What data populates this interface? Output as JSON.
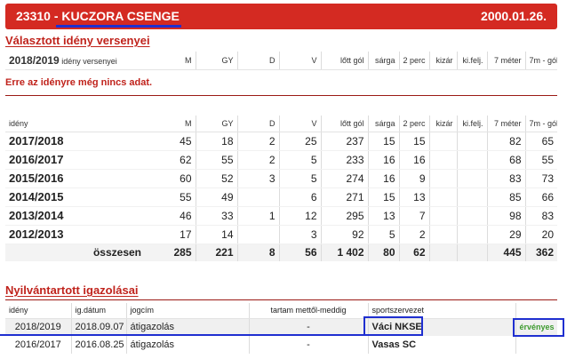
{
  "header": {
    "player_id": "23310",
    "separator": "-",
    "player_name": "KUCZORA CSENGE",
    "birth_date": "2000.01.26."
  },
  "selected_season": {
    "title": "Választott idény versenyei",
    "season": "2018/2019",
    "sub_label": "idény versenyei",
    "columns": [
      "M",
      "GY",
      "D",
      "V",
      "lőtt gól",
      "sárga",
      "2 perc",
      "kizár",
      "ki.felj.",
      "7 méter",
      "7m - gól"
    ],
    "no_data": "Erre az idényre még nincs adat."
  },
  "season_stats": {
    "header_label": "idény",
    "columns": [
      "M",
      "GY",
      "D",
      "V",
      "lőtt gól",
      "sárga",
      "2 perc",
      "kizár",
      "ki.felj.",
      "7 méter",
      "7m - gól"
    ],
    "rows": [
      {
        "season": "2017/2018",
        "values": [
          "45",
          "18",
          "2",
          "25",
          "237",
          "15",
          "15",
          "",
          "",
          "82",
          "65"
        ]
      },
      {
        "season": "2016/2017",
        "values": [
          "62",
          "55",
          "2",
          "5",
          "233",
          "16",
          "16",
          "",
          "",
          "68",
          "55"
        ]
      },
      {
        "season": "2015/2016",
        "values": [
          "60",
          "52",
          "3",
          "5",
          "274",
          "16",
          "9",
          "",
          "",
          "83",
          "73"
        ]
      },
      {
        "season": "2014/2015",
        "values": [
          "55",
          "49",
          "",
          "6",
          "271",
          "15",
          "13",
          "",
          "",
          "85",
          "66"
        ]
      },
      {
        "season": "2013/2014",
        "values": [
          "46",
          "33",
          "1",
          "12",
          "295",
          "13",
          "7",
          "",
          "",
          "98",
          "83"
        ]
      },
      {
        "season": "2012/2013",
        "values": [
          "17",
          "14",
          "",
          "3",
          "92",
          "5",
          "2",
          "",
          "",
          "29",
          "20"
        ]
      }
    ],
    "total": {
      "label": "összesen",
      "values": [
        "285",
        "221",
        "8",
        "56",
        "1 402",
        "80",
        "62",
        "",
        "",
        "445",
        "362"
      ]
    }
  },
  "registrations": {
    "title": "Nyilvántartott igazolásai",
    "columns": [
      "idény",
      "ig.dátum",
      "jogcím",
      "tartam mettől-meddig",
      "sportszervezet",
      ""
    ],
    "rows": [
      {
        "season": "2018/2019",
        "date": "2018.09.07",
        "type": "átigazolás",
        "period": "-",
        "club": "Váci NKSE",
        "status": "érvényes"
      },
      {
        "season": "2016/2017",
        "date": "2016.08.25",
        "type": "átigazolás",
        "period": "-",
        "club": "Vasas SC",
        "status": ""
      }
    ]
  },
  "colors": {
    "header_red": "#d42a22",
    "title_red": "#c0231c",
    "annotation_blue": "#1f2fd0",
    "valid_green": "#3d9a2e"
  }
}
